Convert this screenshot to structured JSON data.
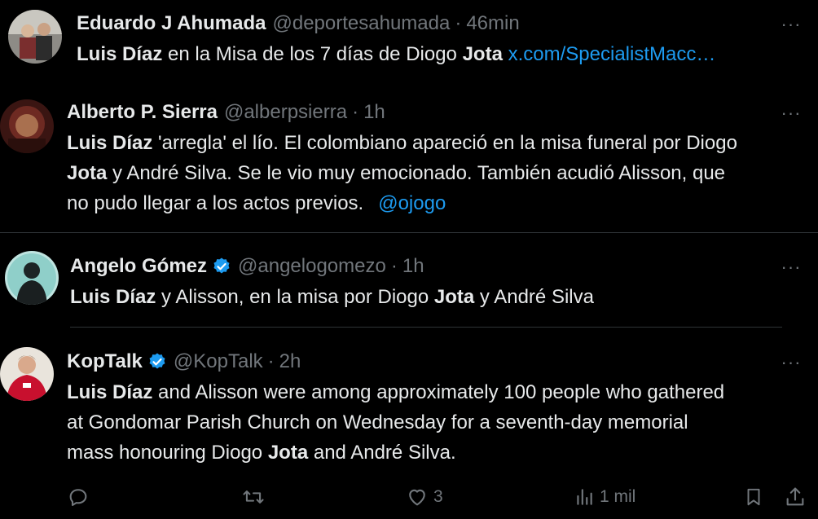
{
  "colors": {
    "background": "#000000",
    "text": "#e7e9ea",
    "muted": "#71767b",
    "link": "#1d9bf0",
    "verified": "#1d9bf0",
    "divider": "#2f3336"
  },
  "tweets": [
    {
      "name": "Eduardo J Ahumada",
      "handle": "@deportesahumada",
      "time": "46min",
      "verified": false,
      "body": {
        "bold1": "Luis Díaz",
        "text1": " en la Misa de los 7 días de Diogo ",
        "bold2": "Jota",
        "link": " x.com/SpecialistMacc…"
      }
    },
    {
      "name": "Alberto P. Sierra",
      "handle": "@alberpsierra",
      "time": "1h",
      "verified": false,
      "body": {
        "bold1": "Luis Díaz",
        "text1": " 'arregla' el lío. El colombiano apareció en la misa funeral por Diogo",
        "bold2": "Jota",
        "text2": " y André Silva. Se le vio muy emocionado. También acudió Alisson, que",
        "text3": "no pudo llegar a los actos previos.",
        "link": "@ojogo"
      }
    },
    {
      "name": "Angelo Gómez",
      "handle": "@angelogomezo",
      "time": "1h",
      "verified": true,
      "body": {
        "bold1": "Luis Díaz",
        "text1": " y Alisson, en la misa por Diogo ",
        "bold2": "Jota",
        "text2": " y André Silva"
      }
    },
    {
      "name": "KopTalk",
      "handle": "@KopTalk",
      "time": "2h",
      "verified": true,
      "body": {
        "bold1": "Luis Díaz",
        "text1": " and Alisson were among approximately 100 people who gathered",
        "text2": "at Gondomar Parish Church on Wednesday for a seventh-day memorial",
        "text3": "mass honouring Diogo ",
        "bold2": "Jota",
        "text4": " and André Silva."
      },
      "actions": {
        "reply_icon": "reply-icon",
        "retweet_icon": "retweet-icon",
        "like_icon": "heart-icon",
        "like_count": "3",
        "views_icon": "views-icon",
        "views_count": "1 mil",
        "bookmark_icon": "bookmark-icon",
        "share_icon": "share-icon"
      }
    }
  ],
  "more_label": "···",
  "separator": "·"
}
